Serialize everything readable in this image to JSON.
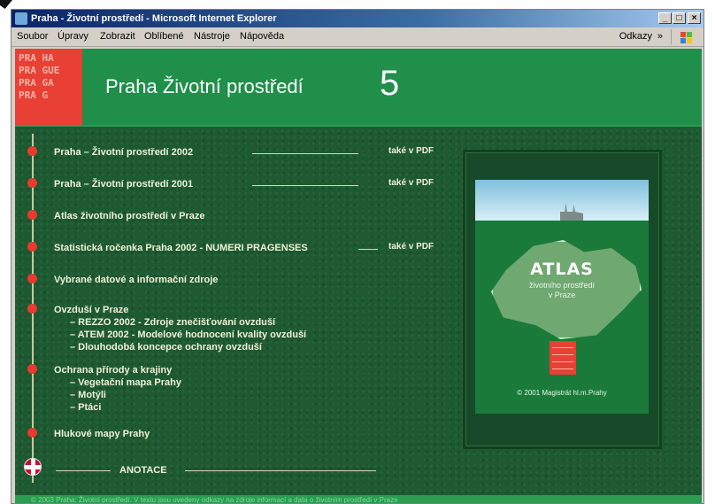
{
  "window": {
    "title": "Praha - Životní prostředí - Microsoft Internet Explorer",
    "minimize": "_",
    "maximize": "□",
    "close": "×"
  },
  "menu": {
    "items": [
      "Soubor",
      "Úpravy",
      "Zobrazit",
      "Oblíbené",
      "Nástroje",
      "Nápověda"
    ],
    "links_label": "Odkazy",
    "chevron": "»"
  },
  "header": {
    "logo_lines": [
      "PRA HA",
      "PRA GUE",
      "PRA GA",
      "PRA G"
    ],
    "title": "Praha Životní prostředí",
    "number": "5"
  },
  "nav": {
    "items": [
      {
        "label": "Praha – Životní prostředí 2002",
        "pdf": "také v PDF"
      },
      {
        "label": "Praha – Životní prostředí 2001",
        "pdf": "také v PDF"
      },
      {
        "label": "Atlas životního prostředí v Praze"
      },
      {
        "label": "Statistická ročenka Praha 2002 - NUMERI PRAGENSES",
        "pdf": "také v PDF"
      },
      {
        "label": "Vybrané datové a informační zdroje"
      },
      {
        "label": "Ovzduší v Praze"
      },
      {
        "label": "Ochrana přírody a krajiny"
      },
      {
        "label": "Hlukové mapy Prahy"
      }
    ],
    "ovzdusi_sub": [
      "– REZZO 2002 - Zdroje znečišťování ovzduší",
      "– ATEM 2002 - Modelové hodnocení kvality ovzduší",
      "– Dlouhodobá koncepce ochrany ovzduší"
    ],
    "priroda_sub": [
      "– Vegetační mapa Prahy",
      "– Motýli",
      "– Ptáci"
    ],
    "anotace": "ANOTACE"
  },
  "atlas": {
    "title": "ATLAS",
    "subtitle_1": "životního prostředí",
    "subtitle_2": "v Praze",
    "copyright": "© 2001 Magistrát hl.m.Prahy"
  },
  "status_text": "© 2003 Praha: Životní prostředí. V textu jsou uvedeny odkazy na zdroje informací a data o životním prostředí v Praze"
}
